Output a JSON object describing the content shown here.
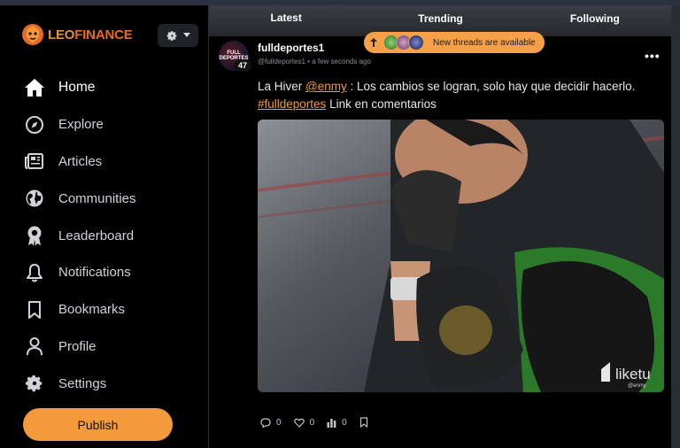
{
  "brand": {
    "leo": "LEO",
    "finance": "FINANCE",
    "accent": "#f39a3b"
  },
  "sidebar": {
    "items": [
      {
        "label": "Home",
        "icon": "home-icon",
        "active": true
      },
      {
        "label": "Explore",
        "icon": "compass-icon"
      },
      {
        "label": "Articles",
        "icon": "newspaper-icon"
      },
      {
        "label": "Communities",
        "icon": "globe-icon"
      },
      {
        "label": "Leaderboard",
        "icon": "medal-icon"
      },
      {
        "label": "Notifications",
        "icon": "bell-icon"
      },
      {
        "label": "Bookmarks",
        "icon": "bookmark-icon"
      },
      {
        "label": "Profile",
        "icon": "user-icon"
      },
      {
        "label": "Settings",
        "icon": "settings-icon"
      }
    ],
    "publish_label": "Publish"
  },
  "tabs": {
    "latest": "Latest",
    "trending": "Trending",
    "following": "Following"
  },
  "banner": {
    "text": "New threads are available"
  },
  "post": {
    "avatar_text": "FULL DEPORTES",
    "reputation": "47",
    "author": "fulldeportes1",
    "handle": "@fulldeportes1",
    "time": "a few seconds ago",
    "text_prefix": "La Hiver ",
    "mention": "@enmy",
    "text_mid": " : Los cambios se logran, solo hay que decidir hacerlo.",
    "hashtag": "#fulldeportes",
    "text_suffix": " Link en comentarios",
    "watermark": "liketu",
    "watermark_sub": "@enmy",
    "counts": {
      "comments": "0",
      "likes": "0",
      "views": "0"
    }
  }
}
